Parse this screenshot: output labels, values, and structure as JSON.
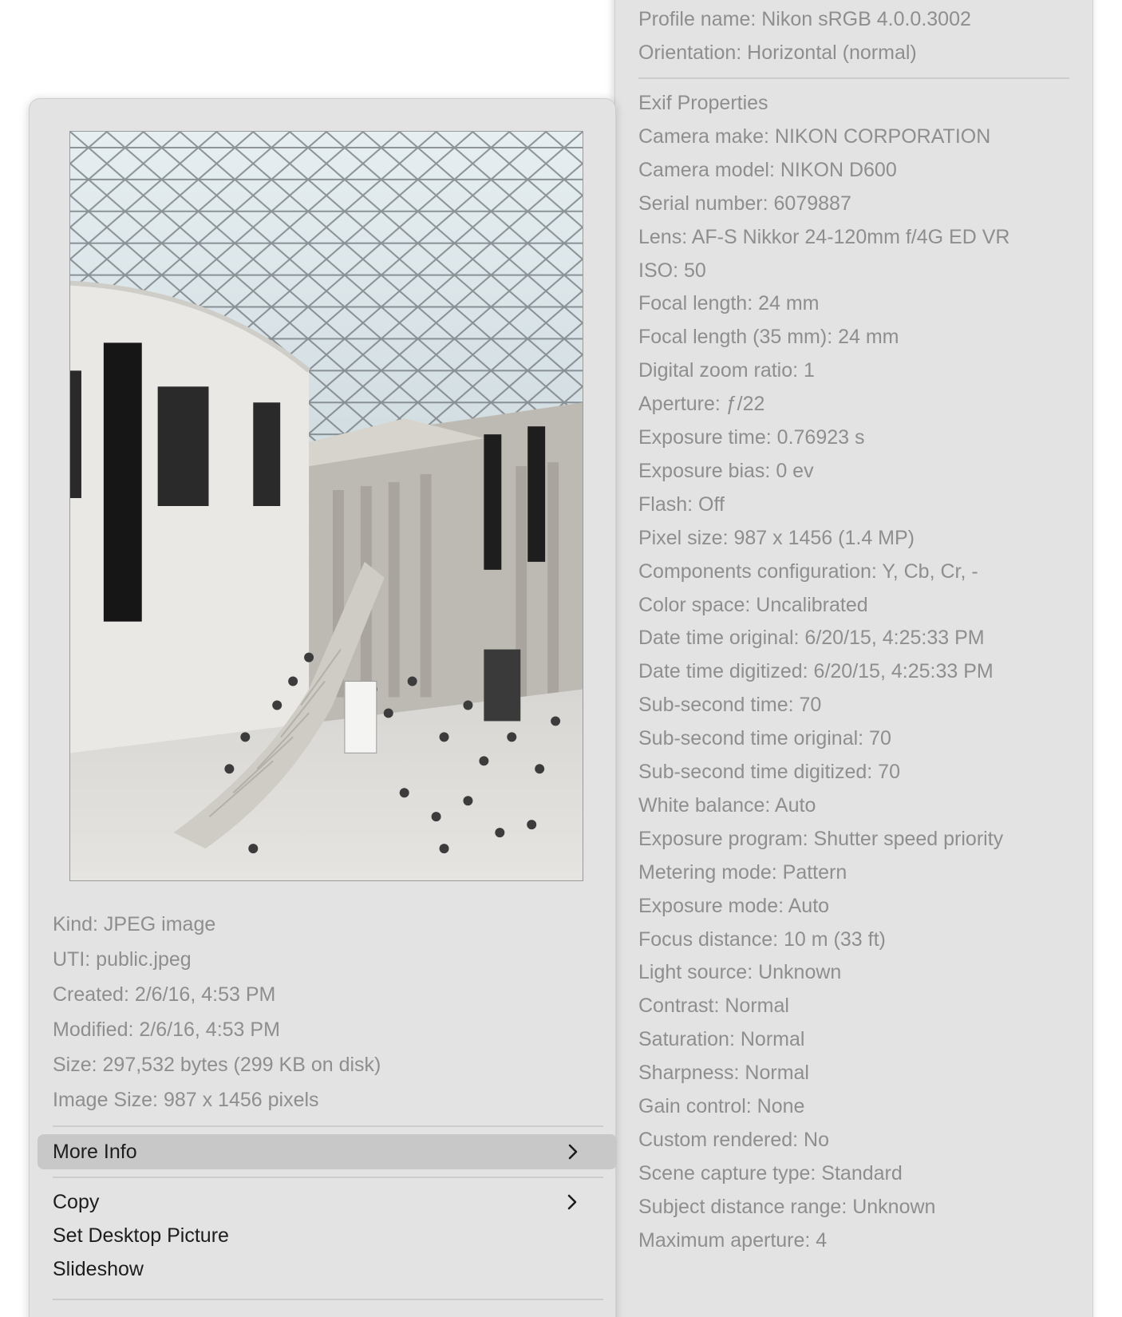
{
  "file_info": {
    "kind": "Kind: JPEG image",
    "uti": "UTI: public.jpeg",
    "created": "Created: 2/6/16, 4:53 PM",
    "modified": "Modified: 2/6/16, 4:53 PM",
    "size": "Size: 297,532 bytes (299 KB on disk)",
    "image_size": "Image Size: 987 x 1456 pixels"
  },
  "menu": {
    "more_info": "More Info",
    "copy": "Copy",
    "set_desktop_picture": "Set Desktop Picture",
    "slideshow": "Slideshow"
  },
  "submenu": {
    "header_lines": [
      "Profile name: Nikon sRGB 4.0.0.3002",
      "Orientation: Horizontal (normal)"
    ],
    "exif_lines": [
      "Exif Properties",
      "Camera make: NIKON CORPORATION",
      "Camera model: NIKON D600",
      "Serial number: 6079887",
      "Lens: AF-S Nikkor 24-120mm f/4G ED VR",
      "ISO: 50",
      "Focal length: 24 mm",
      "Focal length (35 mm): 24 mm",
      "Digital zoom ratio: 1",
      "Aperture: ƒ/22",
      "Exposure time: 0.76923 s",
      "Exposure bias: 0 ev",
      "Flash: Off",
      "Pixel size: 987 x 1456 (1.4 MP)",
      "Components configuration: Y, Cb, Cr, -",
      "Color space: Uncalibrated",
      "Date time original: 6/20/15, 4:25:33 PM",
      "Date time digitized: 6/20/15, 4:25:33 PM",
      "Sub-second time: 70",
      "Sub-second time original: 70",
      "Sub-second time digitized: 70",
      "White balance: Auto",
      "Exposure program: Shutter speed priority",
      "Metering mode: Pattern",
      "Exposure mode: Auto",
      "Focus distance: 10 m (33 ft)",
      "Light source: Unknown",
      "Contrast: Normal",
      "Saturation: Normal",
      "Sharpness: Normal",
      "Gain control: None",
      "Custom rendered: No",
      "Scene capture type: Standard",
      "Subject distance range: Unknown",
      "Maximum aperture: 4"
    ]
  },
  "colors": {
    "menu_background": "#e4e3e3",
    "highlight": "#c9c8c8",
    "secondary_text": "#8f8e8e",
    "primary_text": "#1d1d1d"
  },
  "icons": {
    "more_info_chevron": "chevron-right-icon",
    "copy_chevron": "chevron-right-icon"
  }
}
